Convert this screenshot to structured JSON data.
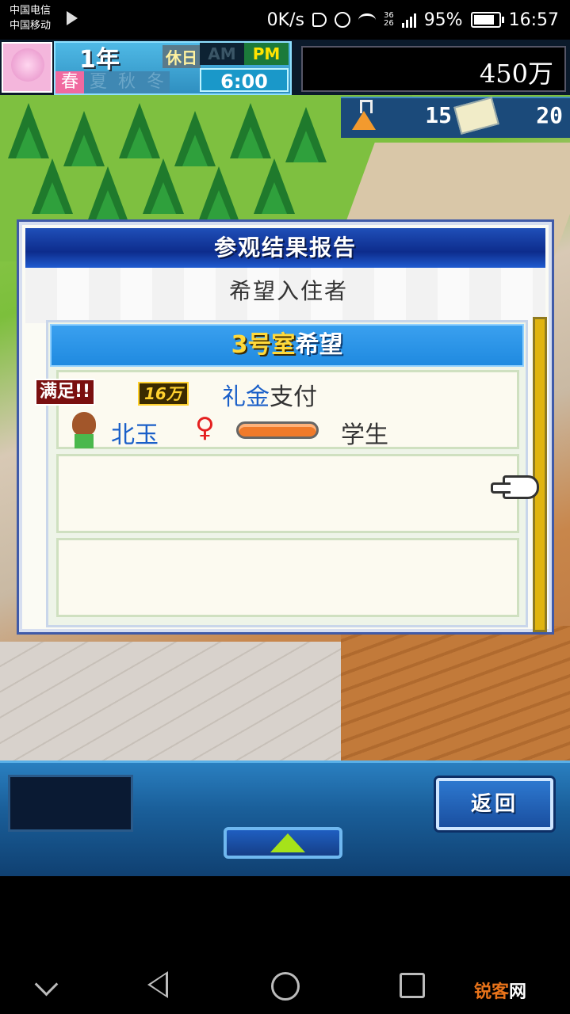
{
  "status_bar": {
    "carrier_1": "中国电信",
    "carrier_2": "中国移动",
    "net_speed": "0K/s",
    "net_type_a": "36",
    "net_type_b": "26",
    "battery": "95%",
    "time": "16:57",
    "battery_level": 0.95
  },
  "hud": {
    "year": "1年",
    "holiday": "休日",
    "seasons": [
      "春",
      "夏",
      "秋",
      "冬"
    ],
    "active_season": "春",
    "am": "AM",
    "pm": "PM",
    "active_period": "PM",
    "clock": "6:00",
    "money": "450万",
    "research_points": "15",
    "ticket_points": "20"
  },
  "dialog": {
    "title": "参观结果报告",
    "subtitle": "希望入住者",
    "room_number": "3号室",
    "room_wish": "希望",
    "entries": [
      {
        "status_badge": "满足!!",
        "amount": "16万",
        "payment_prefix": "礼金",
        "payment_suffix": "支付",
        "name": "北玉",
        "gender_symbol": "♀",
        "occupation": "学生"
      }
    ]
  },
  "controls": {
    "back_label": "返回"
  },
  "watermark": {
    "part1": "锐客",
    "part2": "网"
  },
  "colors": {
    "dialog_title_bg": "#1f4fb8",
    "room_header_bg": "#2a94e8",
    "room_number": "#ffd93a",
    "name_blue": "#1a5fc8",
    "gauge_fill": "#f07a2a",
    "up_arrow": "#a6e21a"
  }
}
